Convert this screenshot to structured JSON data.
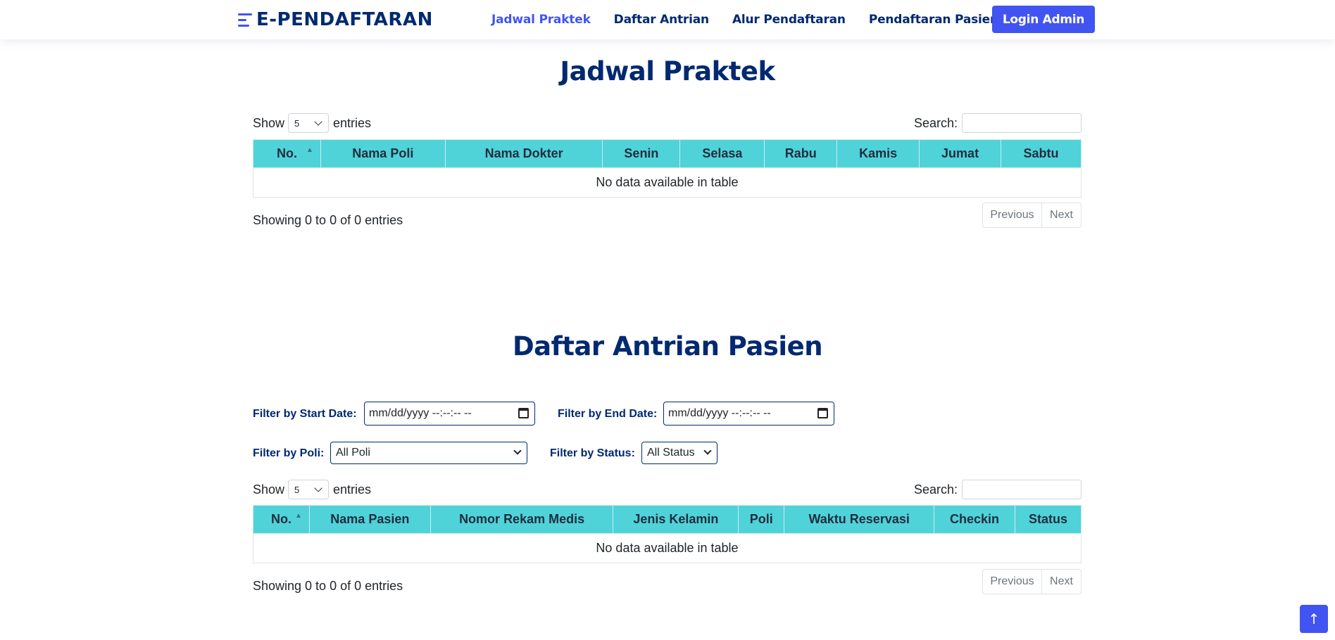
{
  "brand": {
    "name": "E-PENDAFTARAN"
  },
  "nav": {
    "items": [
      {
        "label": "Jadwal Praktek",
        "active": true
      },
      {
        "label": "Daftar Antrian",
        "active": false
      },
      {
        "label": "Alur Pendaftaran",
        "active": false
      },
      {
        "label": "Pendaftaran Pasien",
        "active": false
      }
    ],
    "login_label": "Login Admin"
  },
  "schedule": {
    "title": "Jadwal Praktek",
    "show_label": "Show",
    "entries_label": "entries",
    "page_size": "5",
    "search_label": "Search:",
    "columns": [
      "No.",
      "Nama Poli",
      "Nama Dokter",
      "Senin",
      "Selasa",
      "Rabu",
      "Kamis",
      "Jumat",
      "Sabtu"
    ],
    "empty_message": "No data available in table",
    "info": "Showing 0 to 0 of 0 entries",
    "prev_label": "Previous",
    "next_label": "Next"
  },
  "queue": {
    "title": "Daftar Antrian Pasien",
    "filters": {
      "start_date_label": "Filter by Start Date:",
      "start_date_value": "mm/dd/yyyy --:--:-- --",
      "end_date_label": "Filter by End Date:",
      "end_date_value": "mm/dd/yyyy --:--:-- --",
      "poli_label": "Filter by Poli:",
      "poli_value": "All Poli",
      "status_label": "Filter by Status:",
      "status_value": "All Status"
    },
    "show_label": "Show",
    "entries_label": "entries",
    "page_size": "5",
    "search_label": "Search:",
    "columns": [
      "No.",
      "Nama Pasien",
      "Nomor Rekam Medis",
      "Jenis Kelamin",
      "Poli",
      "Waktu Reservasi",
      "Checkin",
      "Status"
    ],
    "empty_message": "No data available in table",
    "info": "Showing 0 to 0 of 0 entries",
    "prev_label": "Previous",
    "next_label": "Next"
  },
  "icons": {
    "back_to_top": "arrow-up-icon",
    "sort": "sort-ascending-icon",
    "calendar": "calendar-icon",
    "dropdown": "chevron-down-icon"
  },
  "colors": {
    "brand": "#012970",
    "accent": "#4154f1",
    "table_header": "#50d2d9"
  }
}
